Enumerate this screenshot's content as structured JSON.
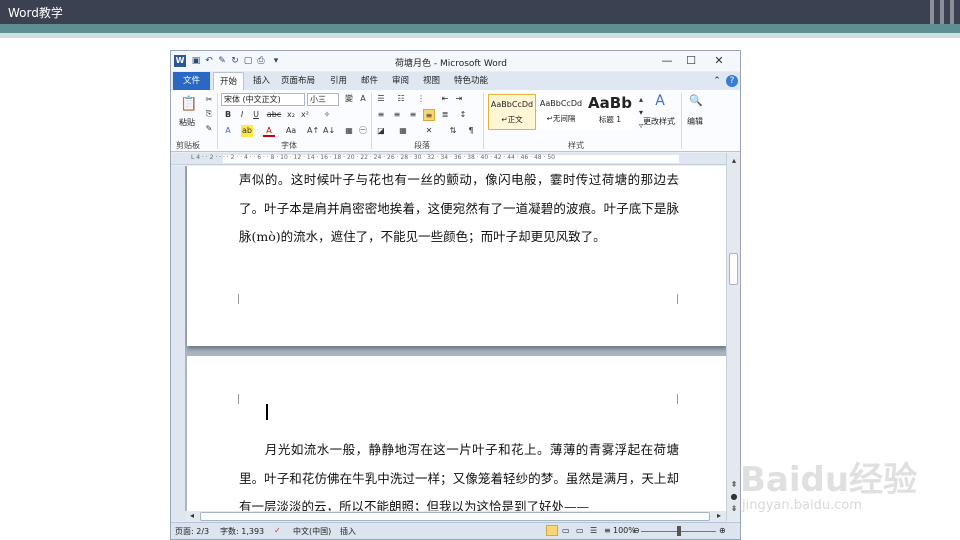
{
  "slide": {
    "title": "Word教学"
  },
  "window": {
    "title": "荷塘月色 - Microsoft Word",
    "logo": "W",
    "controls": {
      "minimize": "—",
      "maximize": "☐",
      "close": "✕"
    }
  },
  "tabs": [
    "文件",
    "开始",
    "插入",
    "页面布局",
    "引用",
    "邮件",
    "审阅",
    "视图",
    "特色功能"
  ],
  "ribbon": {
    "clipboard": {
      "paste_label": "粘贴",
      "group": "剪贴板"
    },
    "font": {
      "name": "宋体 (中文正文)",
      "size": "小三",
      "group": "字体",
      "bold": "B",
      "italic": "I",
      "underline": "U",
      "strike": "abc",
      "subscript": "x₂",
      "superscript": "x²"
    },
    "paragraph": {
      "group": "段落"
    },
    "styles": {
      "group": "样式",
      "items": [
        {
          "sample": "AaBbCcDd",
          "name": "↵正文"
        },
        {
          "sample": "AaBbCcDd",
          "name": "↵无间隔"
        },
        {
          "sample": "AaBb",
          "name": "标题 1"
        }
      ],
      "change_label": "更改样式"
    },
    "editing": {
      "label": "编辑"
    }
  },
  "ruler": {
    "ticks": "L  4 · · 2 · · ·  · 2 · · 4 · · 6 · · 8 · 10 · 12 · 14 · 16 · 18 · 20 · 22 · 24 · 26 · 28 · 30 · 32 · 34 · 36 · 38 · 40 · 42 · 44 · 46 · 48 · 50"
  },
  "document": {
    "page1_text": "声似的。这时候叶子与花也有一丝的颤动，像闪电般，霎时传过荷塘的那边去了。叶子本是肩并肩密密地挨着，这便宛然有了一道凝碧的波痕。叶子底下是脉脉(mò)的流水，遮住了，不能见一些颜色；而叶子却更见风致了。",
    "page2_text": "　　月光如流水一般，静静地泻在这一片叶子和花上。薄薄的青雾浮起在荷塘里。叶子和花仿佛在牛乳中洗过一样；又像笼着轻纱的梦。虽然是满月，天上却有一层淡淡的云，所以不能朗照；但我以为这恰是到了好处——"
  },
  "status": {
    "page": "页面: 2/3",
    "words": "字数: 1,393",
    "language": "中文(中国)",
    "mode": "插入",
    "zoom": "100%"
  },
  "watermark": {
    "logo": "Baidu经验",
    "url": "jingyan.baidu.com"
  }
}
